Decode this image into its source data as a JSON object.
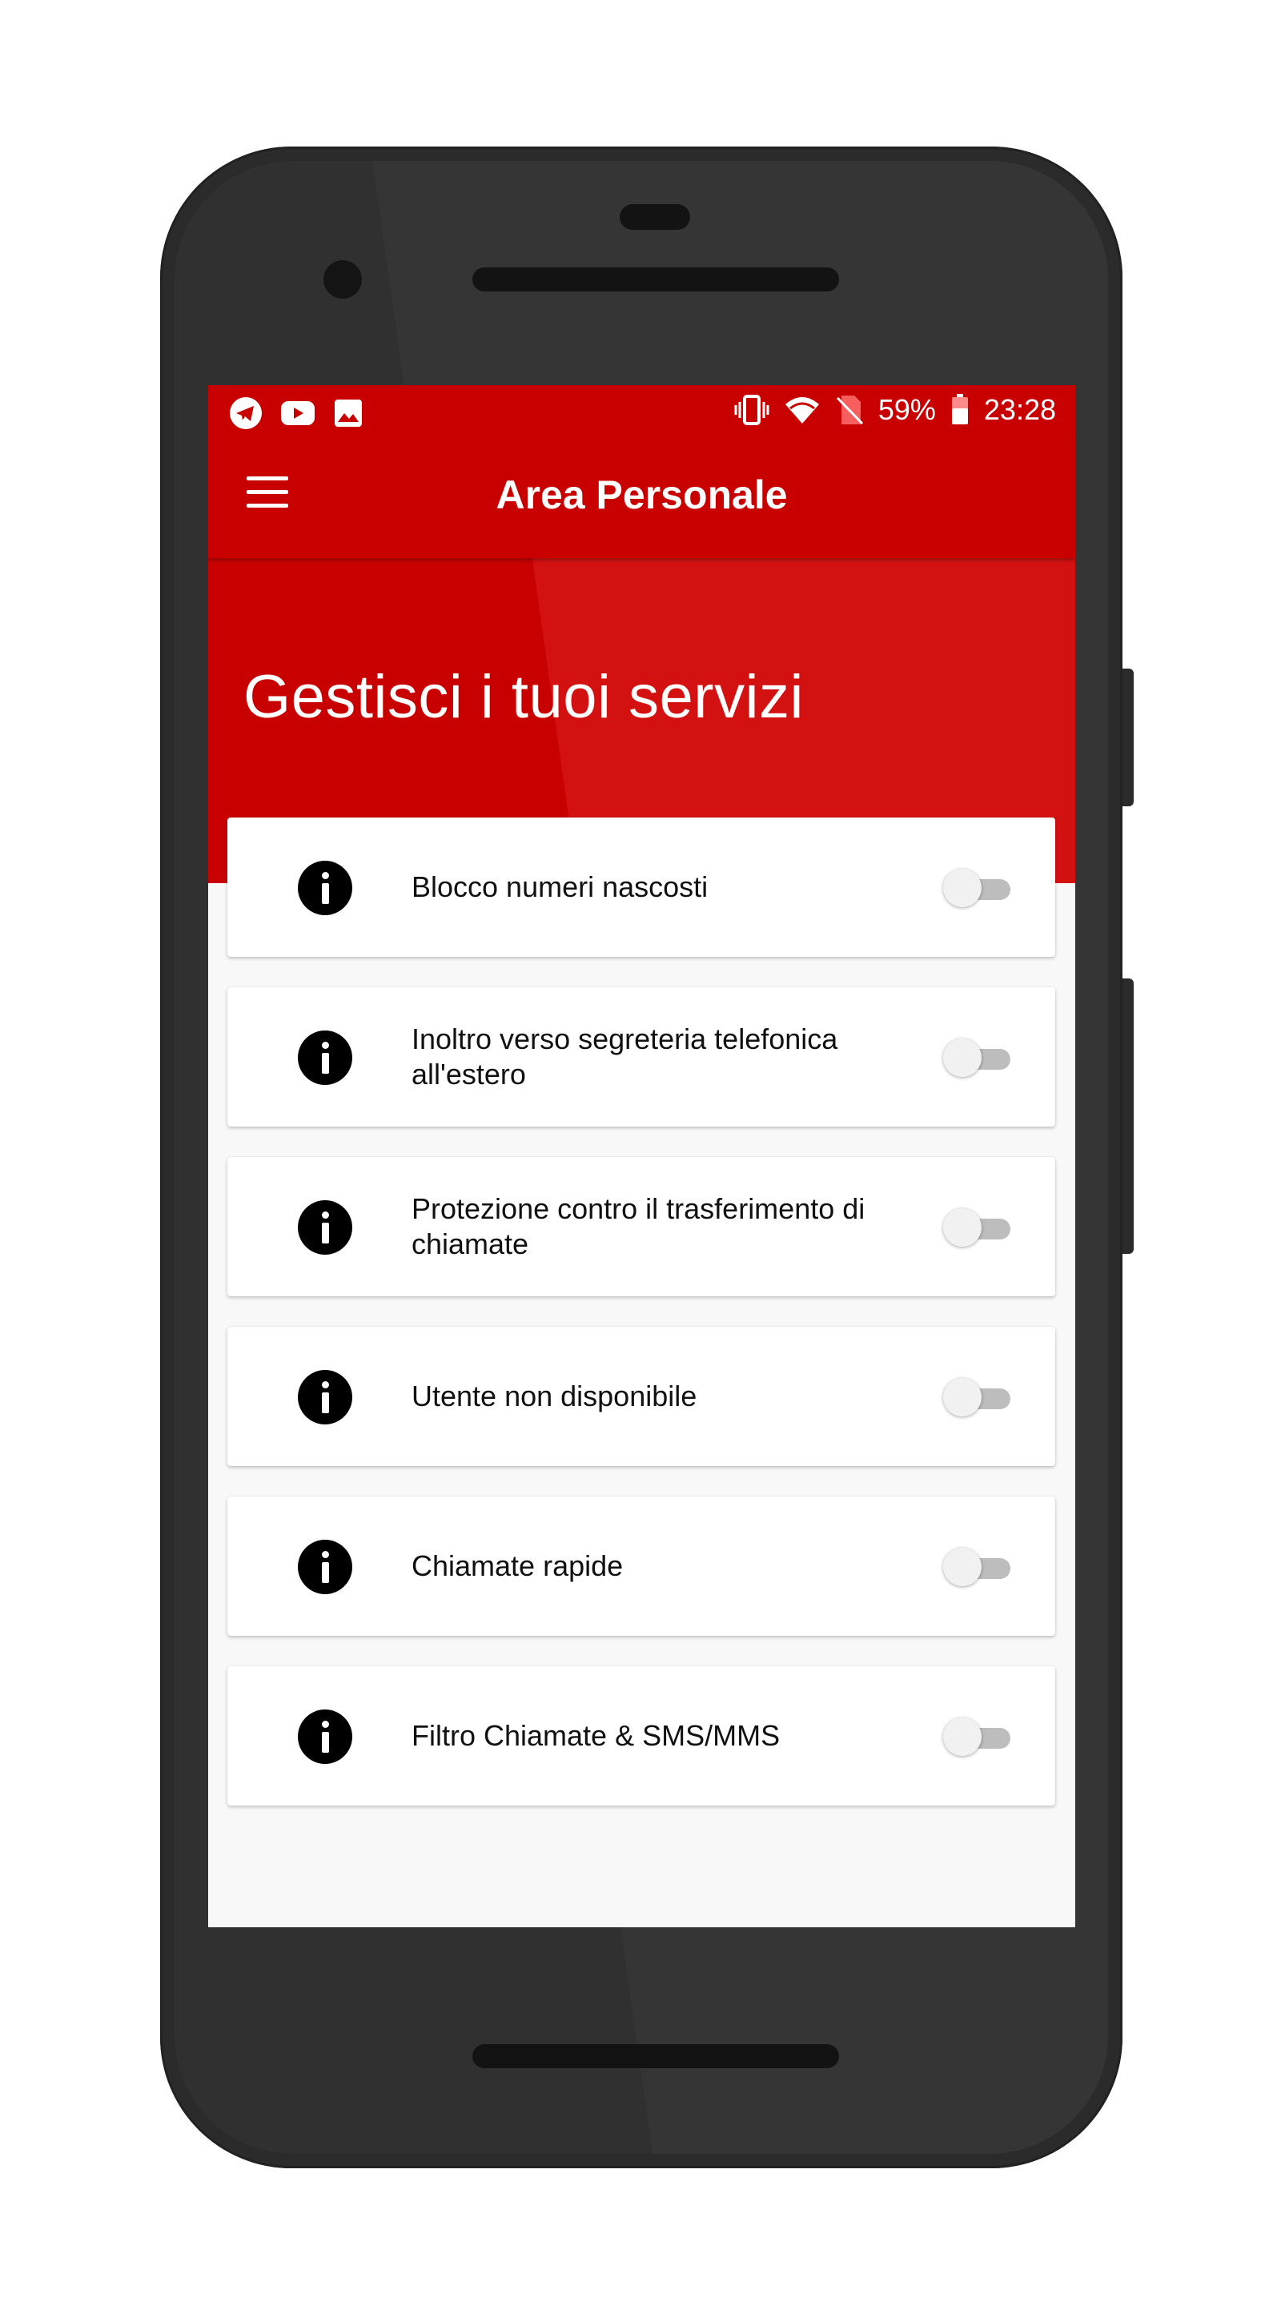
{
  "status_bar": {
    "battery": "59%",
    "time": "23:28",
    "left_icons": [
      "telegram-icon",
      "youtube-icon",
      "gallery-icon"
    ],
    "right_icons": [
      "vibrate-icon",
      "wifi-icon",
      "no-sim-icon",
      "battery-icon"
    ]
  },
  "appbar": {
    "title": "Area Personale",
    "menu_icon": "hamburger-menu-icon"
  },
  "hero": {
    "title": "Gestisci i tuoi servizi"
  },
  "colors": {
    "brand_red": "#c90000",
    "background": "#f8f8f8",
    "toggle_off_track": "#bdbdbd"
  },
  "services": [
    {
      "label": "Blocco numeri nascosti",
      "enabled": false
    },
    {
      "label": "Inoltro verso segreteria telefonica all'estero",
      "enabled": false
    },
    {
      "label": "Protezione contro il trasferimento di chiamate",
      "enabled": false
    },
    {
      "label": "Utente non disponibile",
      "enabled": false
    },
    {
      "label": "Chiamate rapide",
      "enabled": false
    },
    {
      "label": "Filtro Chiamate & SMS/MMS",
      "enabled": false
    }
  ]
}
